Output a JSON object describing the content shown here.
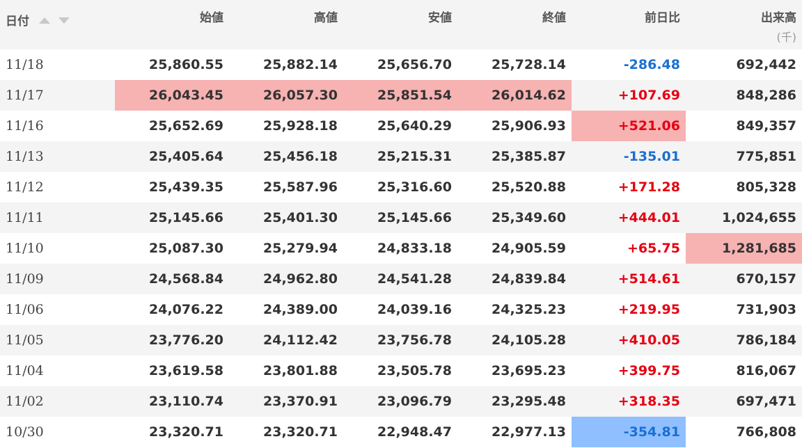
{
  "headers": {
    "date": "日付",
    "open": "始値",
    "high": "高値",
    "low": "安値",
    "close": "終値",
    "change": "前日比",
    "volume": "出来高",
    "volume_unit": "(千)"
  },
  "colors": {
    "up": "#e60012",
    "down": "#1a6fd1",
    "highlight_red": "#f7b2b2",
    "highlight_blue": "#8fbfff",
    "stripe": "#f4f4f4"
  },
  "sort_icons": [
    "sort-ascending-icon",
    "sort-descending-icon"
  ],
  "rows": [
    {
      "date": "11/18",
      "open": "25,860.55",
      "high": "25,882.14",
      "low": "25,656.70",
      "close": "25,728.14",
      "change": "-286.48",
      "volume": "692,442",
      "dir": "down",
      "hl": {}
    },
    {
      "date": "11/17",
      "open": "26,043.45",
      "high": "26,057.30",
      "low": "25,851.54",
      "close": "26,014.62",
      "change": "+107.69",
      "volume": "848,286",
      "dir": "up",
      "hl": {
        "open": "red",
        "high": "red",
        "low": "red",
        "close": "red"
      }
    },
    {
      "date": "11/16",
      "open": "25,652.69",
      "high": "25,928.18",
      "low": "25,640.29",
      "close": "25,906.93",
      "change": "+521.06",
      "volume": "849,357",
      "dir": "up",
      "hl": {
        "change": "red"
      }
    },
    {
      "date": "11/13",
      "open": "25,405.64",
      "high": "25,456.18",
      "low": "25,215.31",
      "close": "25,385.87",
      "change": "-135.01",
      "volume": "775,851",
      "dir": "down",
      "hl": {}
    },
    {
      "date": "11/12",
      "open": "25,439.35",
      "high": "25,587.96",
      "low": "25,316.60",
      "close": "25,520.88",
      "change": "+171.28",
      "volume": "805,328",
      "dir": "up",
      "hl": {}
    },
    {
      "date": "11/11",
      "open": "25,145.66",
      "high": "25,401.30",
      "low": "25,145.66",
      "close": "25,349.60",
      "change": "+444.01",
      "volume": "1,024,655",
      "dir": "up",
      "hl": {}
    },
    {
      "date": "11/10",
      "open": "25,087.30",
      "high": "25,279.94",
      "low": "24,833.18",
      "close": "24,905.59",
      "change": "+65.75",
      "volume": "1,281,685",
      "dir": "up",
      "hl": {
        "volume": "red"
      }
    },
    {
      "date": "11/09",
      "open": "24,568.84",
      "high": "24,962.80",
      "low": "24,541.28",
      "close": "24,839.84",
      "change": "+514.61",
      "volume": "670,157",
      "dir": "up",
      "hl": {}
    },
    {
      "date": "11/06",
      "open": "24,076.22",
      "high": "24,389.00",
      "low": "24,039.16",
      "close": "24,325.23",
      "change": "+219.95",
      "volume": "731,903",
      "dir": "up",
      "hl": {}
    },
    {
      "date": "11/05",
      "open": "23,776.20",
      "high": "24,112.42",
      "low": "23,756.78",
      "close": "24,105.28",
      "change": "+410.05",
      "volume": "786,184",
      "dir": "up",
      "hl": {}
    },
    {
      "date": "11/04",
      "open": "23,619.58",
      "high": "23,801.88",
      "low": "23,505.78",
      "close": "23,695.23",
      "change": "+399.75",
      "volume": "816,067",
      "dir": "up",
      "hl": {}
    },
    {
      "date": "11/02",
      "open": "23,110.74",
      "high": "23,370.91",
      "low": "23,096.79",
      "close": "23,295.48",
      "change": "+318.35",
      "volume": "697,471",
      "dir": "up",
      "hl": {}
    },
    {
      "date": "10/30",
      "open": "23,320.71",
      "high": "23,320.71",
      "low": "22,948.47",
      "close": "22,977.13",
      "change": "-354.81",
      "volume": "766,808",
      "dir": "down",
      "hl": {
        "change": "blue"
      }
    }
  ]
}
